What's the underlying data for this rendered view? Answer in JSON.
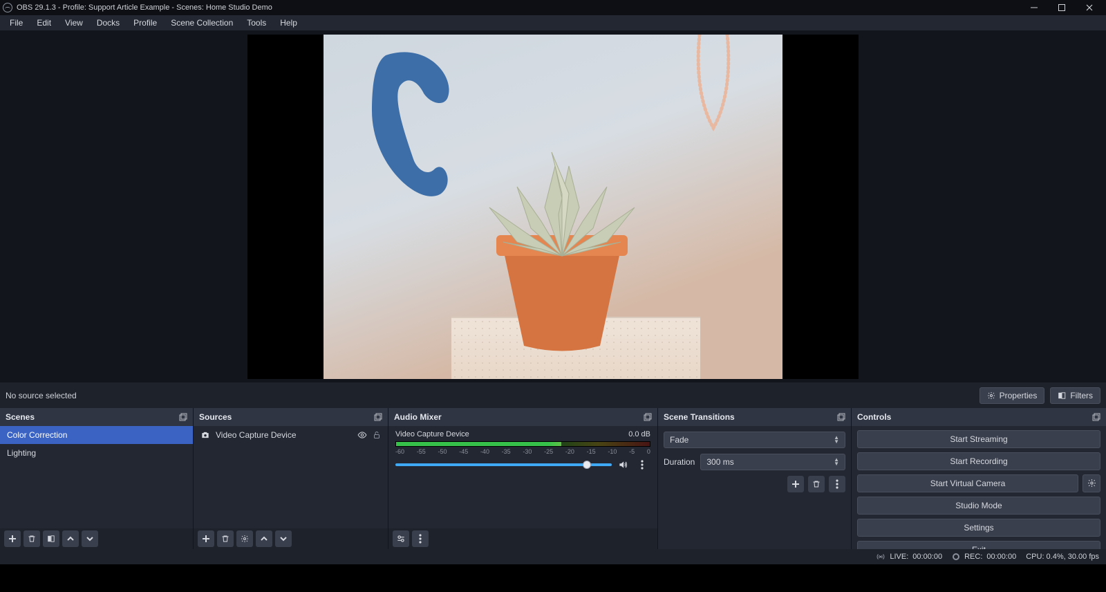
{
  "window": {
    "title": "OBS 29.1.3 - Profile: Support Article Example - Scenes: Home Studio Demo"
  },
  "menubar": {
    "items": [
      "File",
      "Edit",
      "View",
      "Docks",
      "Profile",
      "Scene Collection",
      "Tools",
      "Help"
    ]
  },
  "context_toolbar": {
    "status": "No source selected",
    "properties": "Properties",
    "filters": "Filters"
  },
  "scenes": {
    "title": "Scenes",
    "items": [
      {
        "label": "Color Correction",
        "selected": true
      },
      {
        "label": "Lighting",
        "selected": false
      }
    ]
  },
  "sources": {
    "title": "Sources",
    "items": [
      {
        "label": "Video Capture Device",
        "visible": true,
        "locked": false
      }
    ]
  },
  "audio_mixer": {
    "title": "Audio Mixer",
    "channels": [
      {
        "name": "Video Capture Device",
        "db": "0.0 dB",
        "ticks": [
          "-60",
          "-55",
          "-50",
          "-45",
          "-40",
          "-35",
          "-30",
          "-25",
          "-20",
          "-15",
          "-10",
          "-5",
          "0"
        ]
      }
    ]
  },
  "scene_transitions": {
    "title": "Scene Transitions",
    "current": "Fade",
    "duration_label": "Duration",
    "duration_value": "300 ms"
  },
  "controls": {
    "title": "Controls",
    "start_streaming": "Start Streaming",
    "start_recording": "Start Recording",
    "start_virtual_camera": "Start Virtual Camera",
    "studio_mode": "Studio Mode",
    "settings": "Settings",
    "exit": "Exit"
  },
  "statusbar": {
    "live_label": "LIVE:",
    "live_time": "00:00:00",
    "rec_label": "REC:",
    "rec_time": "00:00:00",
    "cpu": "CPU: 0.4%, 30.00 fps"
  }
}
